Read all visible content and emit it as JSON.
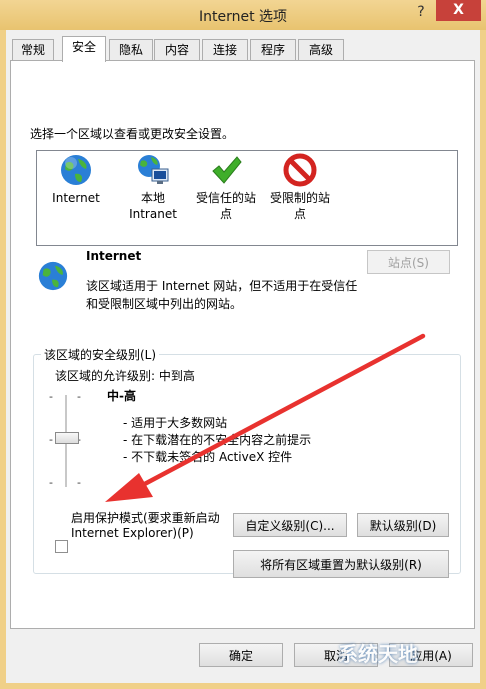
{
  "window": {
    "title": "Internet 选项",
    "help": "?",
    "close": "X"
  },
  "tabs": [
    {
      "label": "常规"
    },
    {
      "label": "安全"
    },
    {
      "label": "隐私"
    },
    {
      "label": "内容"
    },
    {
      "label": "连接"
    },
    {
      "label": "程序"
    },
    {
      "label": "高级"
    }
  ],
  "security": {
    "zone_prompt": "选择一个区域以查看或更改安全设置。",
    "zones": [
      {
        "line1": "Internet",
        "line2": ""
      },
      {
        "line1": "本地",
        "line2": "Intranet"
      },
      {
        "line1": "受信任的站",
        "line2": "点"
      },
      {
        "line1": "受限制的站",
        "line2": "点"
      }
    ],
    "selected_zone_title": "Internet",
    "selected_zone_desc_1": "该区域适用于 Internet 网站，但不适用于在受信任",
    "selected_zone_desc_2": "和受限制区域中列出的网站。",
    "sites_button": "站点(S)",
    "level_group_title": "该区域的安全级别(L)",
    "allowed_levels": "该区域的允许级别: 中到高",
    "level_name": "中-高",
    "bullets": [
      "- 适用于大多数网站",
      "- 在下载潜在的不安全内容之前提示",
      "- 不下载未签名的 ActiveX 控件"
    ],
    "protected_mode_1": "启用保护模式(要求重新启动",
    "protected_mode_2": "Internet Explorer)(P)",
    "custom_level_button": "自定义级别(C)...",
    "default_level_button": "默认级别(D)",
    "reset_all_button": "将所有区域重置为默认级别(R)"
  },
  "footer": {
    "ok": "确定",
    "cancel": "取消",
    "apply": "应用(A)"
  },
  "watermark": "系统天地"
}
